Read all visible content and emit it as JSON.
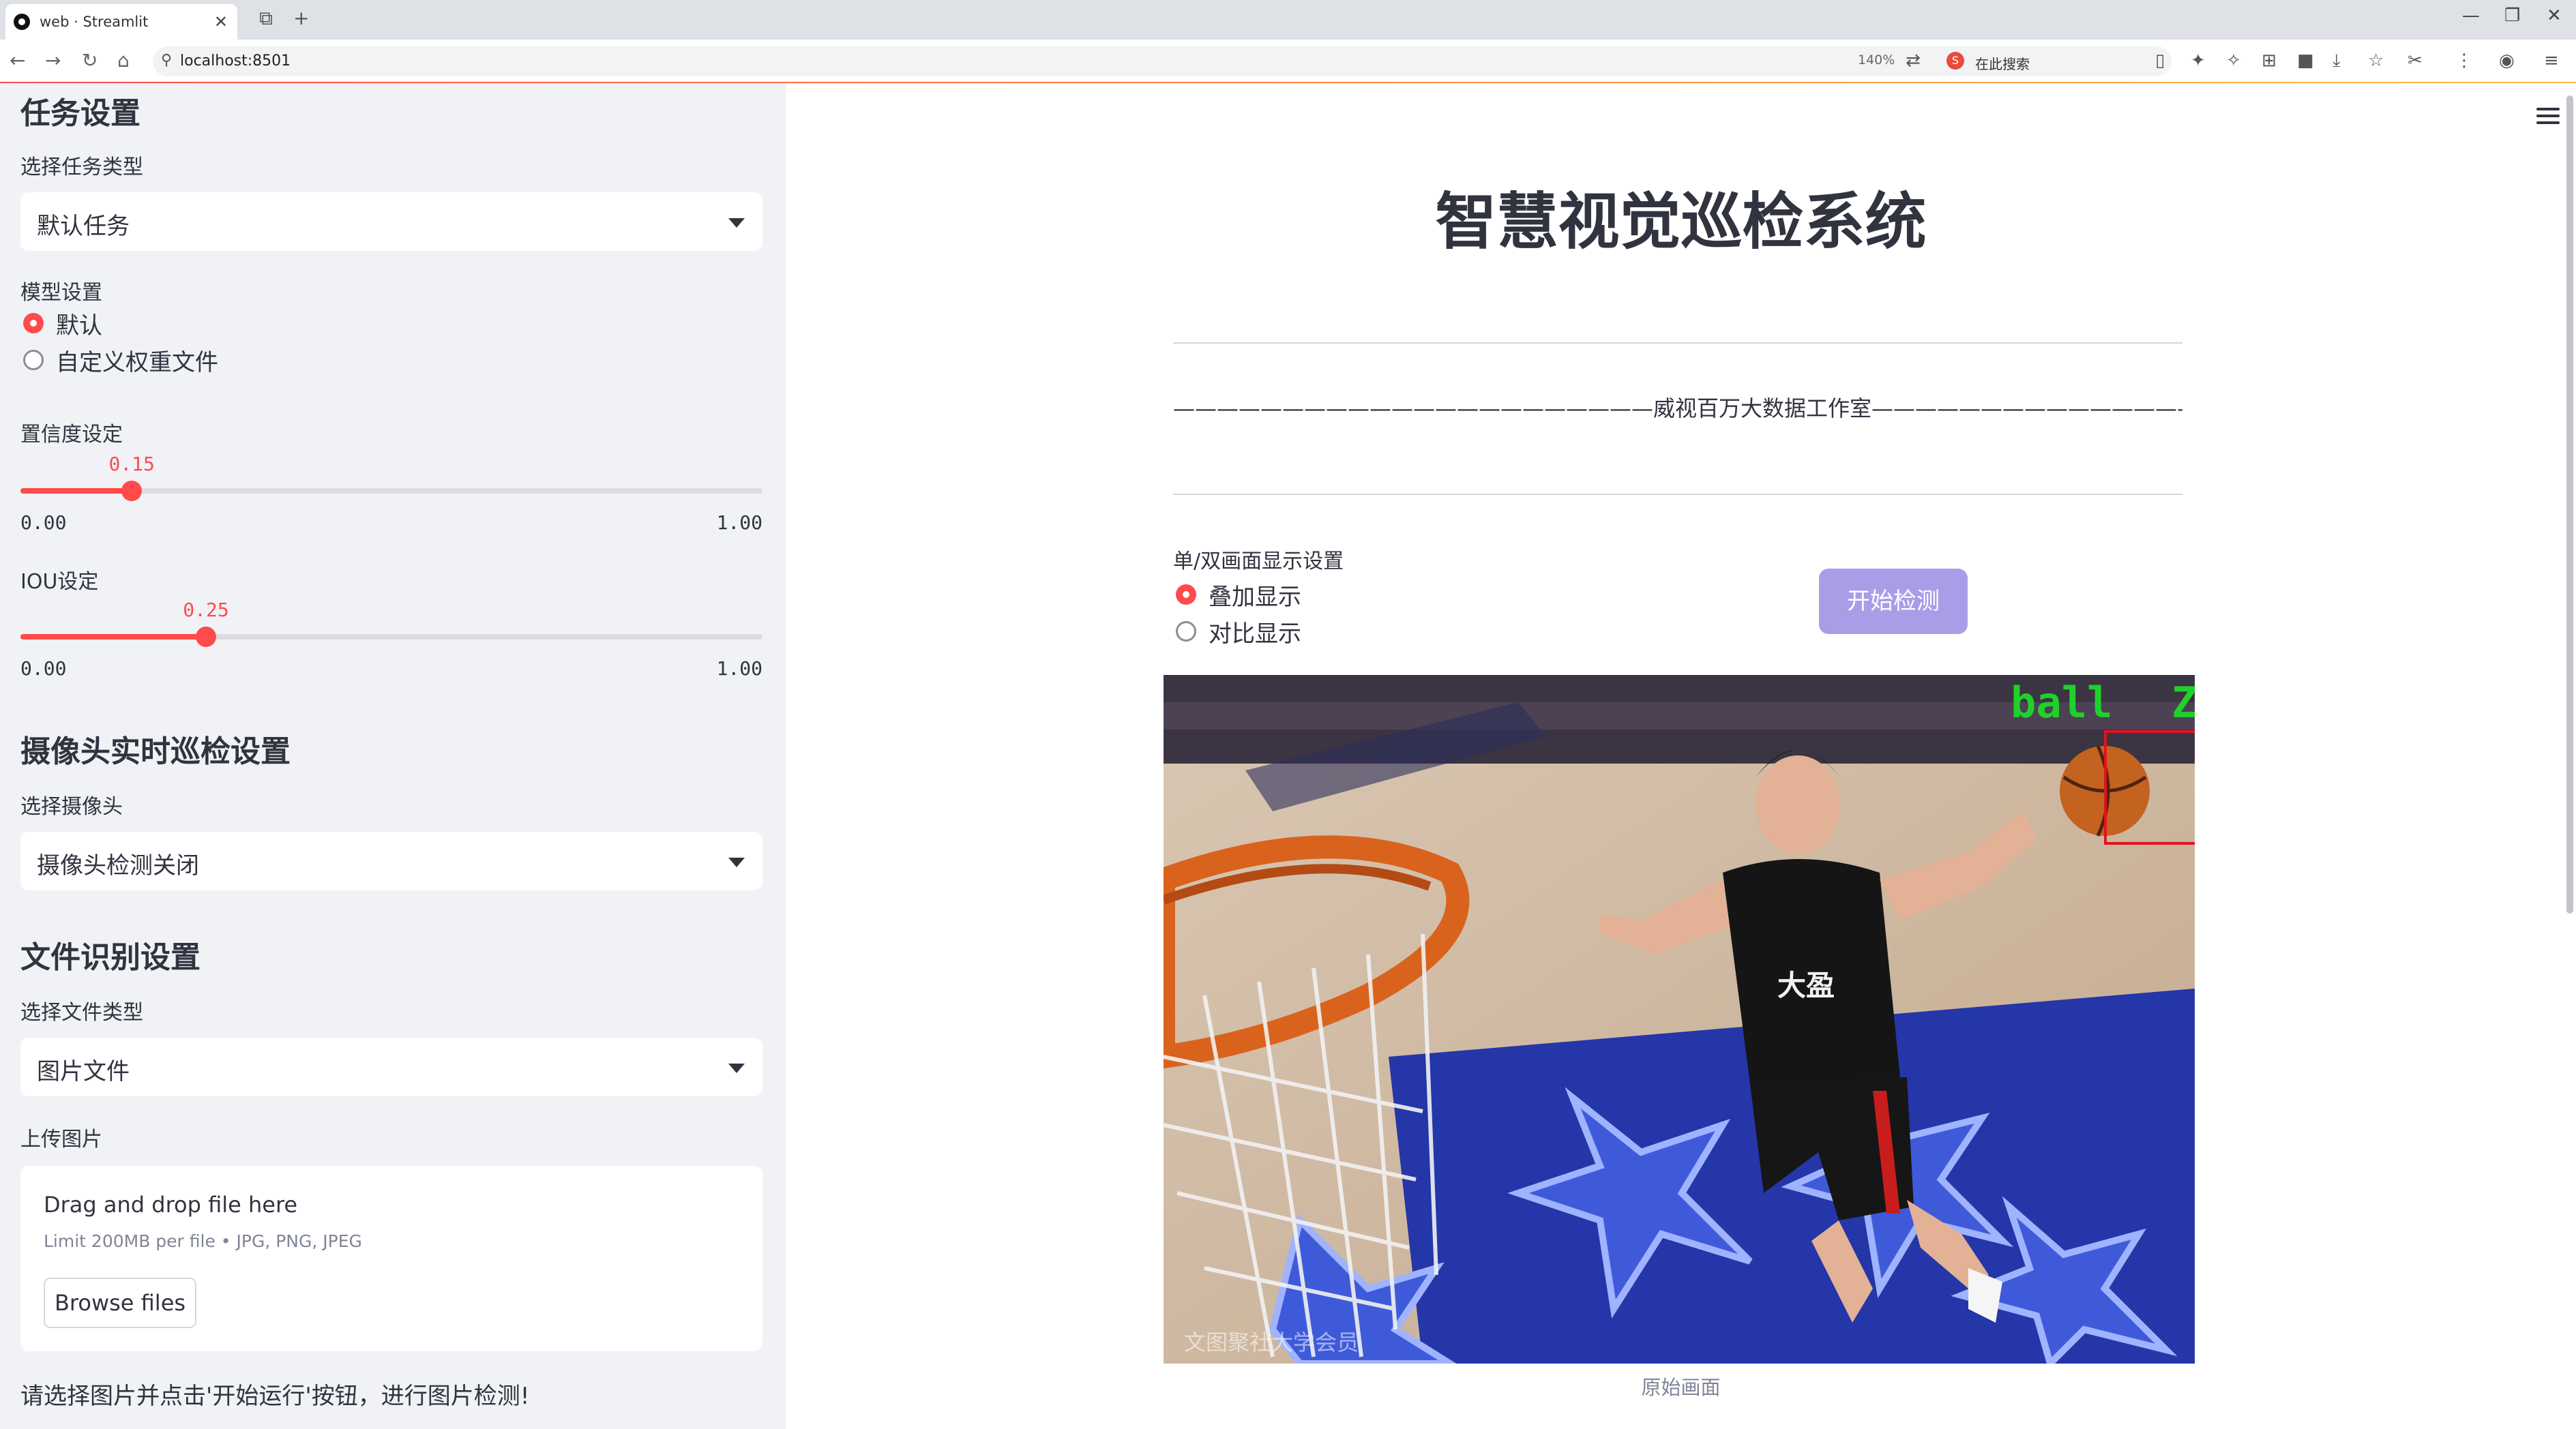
{
  "browser": {
    "tab_title": "web · Streamlit",
    "url": "localhost:8501",
    "zoom": "140%",
    "search_placeholder": "在此搜索",
    "search_engine_logo": "S"
  },
  "sidebar": {
    "task_heading": "任务设置",
    "task_type_label": "选择任务类型",
    "task_type_value": "默认任务",
    "model_label": "模型设置",
    "model_options": [
      "默认",
      "自定义权重文件"
    ],
    "model_selected_index": 0,
    "conf_label": "置信度设定",
    "conf_value": 0.15,
    "conf_value_text": "0.15",
    "conf_min": "0.00",
    "conf_max": "1.00",
    "iou_label": "IOU设定",
    "iou_value": 0.25,
    "iou_value_text": "0.25",
    "iou_min": "0.00",
    "iou_max": "1.00",
    "camera_heading": "摄像头实时巡检设置",
    "camera_label": "选择摄像头",
    "camera_value": "摄像头检测关闭",
    "file_heading": "文件识别设置",
    "file_type_label": "选择文件类型",
    "file_type_value": "图片文件",
    "upload_label": "上传图片",
    "dropzone_title": "Drag and drop file here",
    "dropzone_limit": "Limit 200MB per file • JPG, PNG, JPEG",
    "browse_label": "Browse files",
    "note": "请选择图片并点击'开始运行'按钮，进行图片检测!"
  },
  "main": {
    "title": "智慧视觉巡检系统",
    "subtitle": "——————————————————————威视百万大数据工作室——————————————————————",
    "display_mode_label": "单/双画面显示设置",
    "display_options": [
      "叠加显示",
      "对比显示"
    ],
    "display_selected_index": 0,
    "start_button": "开始检测",
    "detection_label": "ball",
    "detection_label_tail": "Z",
    "caption": "原始画面",
    "watermark": "文图聚社大学会员"
  },
  "colors": {
    "accent": "#ff4b4b",
    "primary_button": "#a89ee8",
    "sidebar_bg": "#f0f2f6",
    "text": "#31333f",
    "detection_box": "#e0141e",
    "detection_text": "#1fd12a"
  },
  "icons": [
    "back-icon",
    "forward-icon",
    "reload-icon",
    "home-icon",
    "menu-icon",
    "dropdown-chevron-icon"
  ]
}
